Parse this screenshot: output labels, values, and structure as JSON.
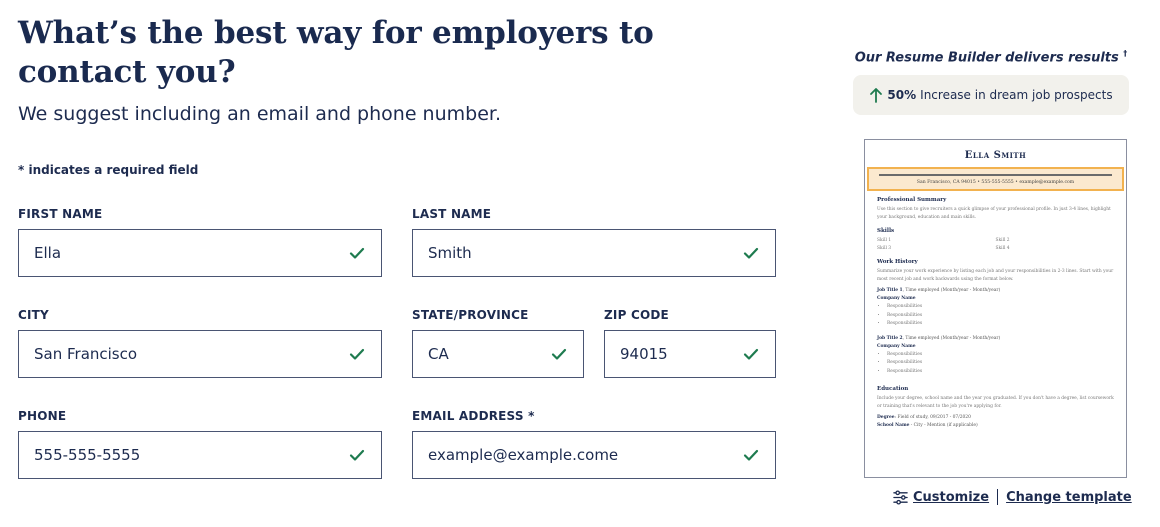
{
  "heading": "What’s the best way for employers to contact you?",
  "subheading": "We suggest including an email and phone number.",
  "required_note": "* indicates a required field",
  "fields": {
    "first_name": {
      "label": "FIRST NAME",
      "value": "Ella"
    },
    "last_name": {
      "label": "LAST NAME",
      "value": "Smith"
    },
    "city": {
      "label": "CITY",
      "value": "San Francisco"
    },
    "state": {
      "label": "STATE/PROVINCE",
      "value": "CA"
    },
    "zip": {
      "label": "ZIP CODE",
      "value": "94015"
    },
    "phone": {
      "label": "PHONE",
      "value": "555-555-5555"
    },
    "email": {
      "label": "EMAIL ADDRESS *",
      "value": "example@example.come"
    }
  },
  "results": {
    "title": "Our Resume Builder delivers results",
    "footnote": "†",
    "stat": "50%",
    "stat_text": "Increase in dream job prospects"
  },
  "resume": {
    "name": "Ella Smith",
    "contact": "San Francisco, CA 94015  •  555-555-5555  •  example@example.com",
    "summary_heading": "Professional Summary",
    "summary_text": "Use this section to give recruiters a quick glimpse of your professional profile. In just 3-4 lines, highlight your background, education and main skills.",
    "skills_heading": "Skills",
    "skills": [
      "Skill 1",
      "Skill 2",
      "Skill 3",
      "Skill 4"
    ],
    "work_heading": "Work History",
    "work_text": "Summarize your work experience by listing each job and your responsibilities in 2-3 lines. Start with your most recent job and work backwards using the format below.",
    "job1_title": "Job Title 1",
    "job1_dates": ", Time employed (Month/year - Month/year)",
    "job2_title": "Job Title 2",
    "job2_dates": ", Time employed (Month/year - Month/year)",
    "company": "Company Name",
    "responsibility": "Responsibilities",
    "education_heading": "Education",
    "education_text": "Include your degree, school name and the year you graduated. If you don't have a degree, list coursework or training that's relevant to the job you're applying for.",
    "degree_label": "Degree",
    "degree_text": ": Field of study, 09/2017 - 07/2020",
    "school_label": "School Name",
    "school_text": " - City - Mention (if applicable)"
  },
  "links": {
    "customize": "Customize",
    "change_template": "Change template"
  },
  "colors": {
    "navy": "#1d2b4f",
    "check": "#1e7b4f",
    "highlight": "#fbe9cf",
    "highlight_border": "#f2b24f",
    "stat_box": "#f2f1ec"
  }
}
